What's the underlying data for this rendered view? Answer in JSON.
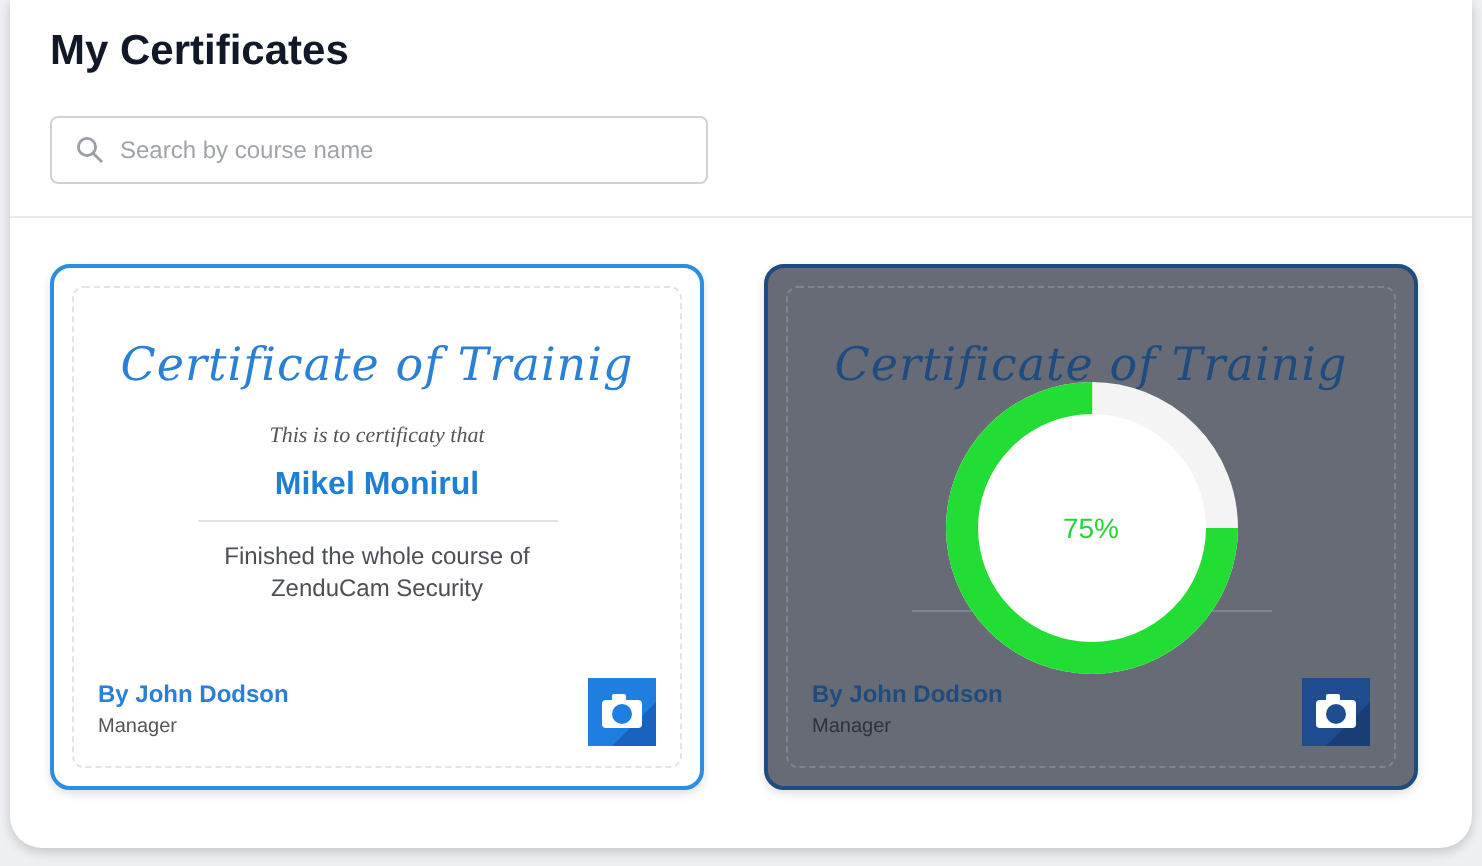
{
  "title": "My Certificates",
  "search": {
    "placeholder": "Search by course name"
  },
  "certificates": [
    {
      "kind": "complete",
      "heading": "Certificate of Trainig",
      "subheading": "This is to certificaty that",
      "recipient": "Mikel Monirul",
      "body": "Finished the whole course of ZenduCam Security",
      "signer": "By John Dodson",
      "role": "Manager"
    },
    {
      "kind": "in_progress",
      "heading": "Certificate of Trainig",
      "signer": "By John Dodson",
      "role": "Manager",
      "progress": {
        "level": 0.75,
        "label": "75%"
      }
    }
  ]
}
